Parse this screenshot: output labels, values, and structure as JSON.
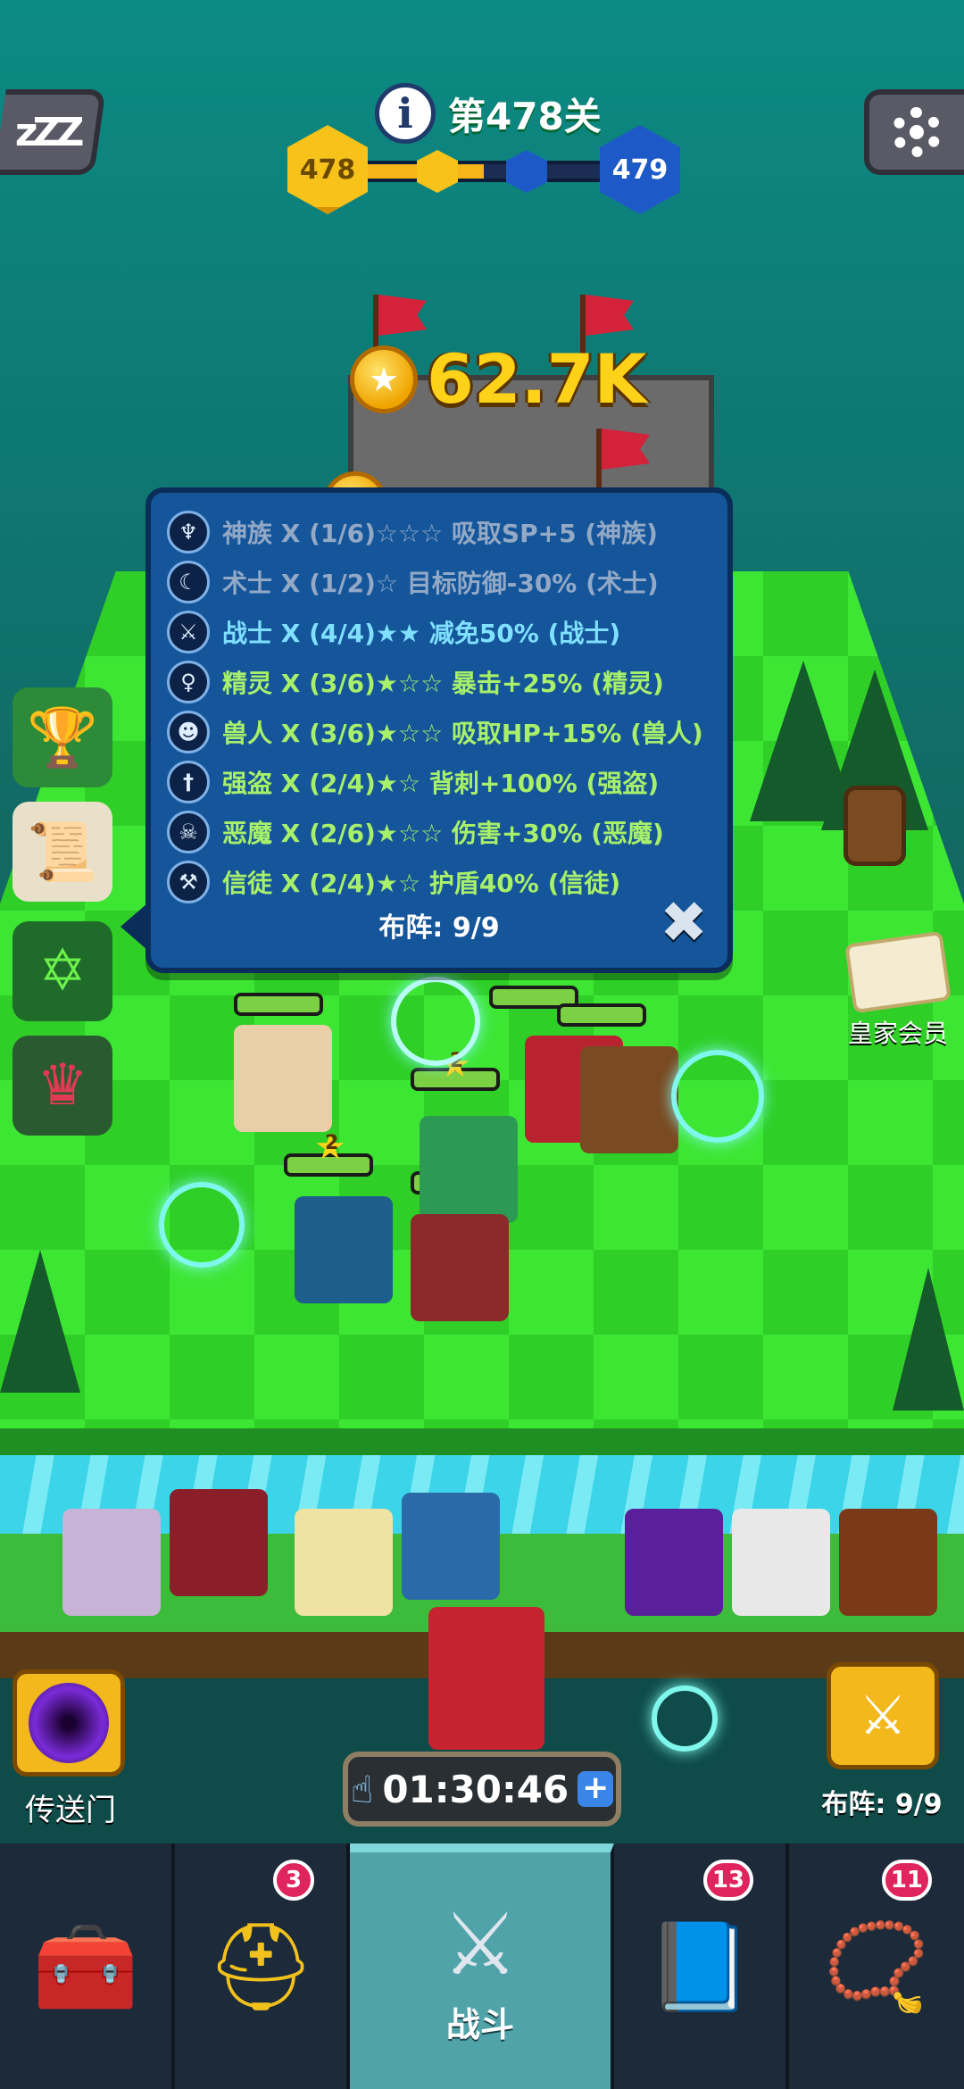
{
  "hud": {
    "level_label": "第478关",
    "current_level": "478",
    "next_level": "479",
    "progress": 0.5,
    "sleep_label": "zZZ"
  },
  "reward": {
    "amount": "62.7K"
  },
  "synergy_panel": {
    "rows": [
      {
        "icon": "wings-icon",
        "text": "神族 X (1/6)☆☆☆ 吸取SP+5 (神族)",
        "state": "dim"
      },
      {
        "icon": "warlock-icon",
        "text": "术士 X (1/2)☆ 目标防御-30% (术士)",
        "state": "dim"
      },
      {
        "icon": "sword-icon",
        "text": "战士 X (4/4)★★ 减免50% (战士)",
        "state": "full"
      },
      {
        "icon": "elf-icon",
        "text": "精灵 X (3/6)★☆☆ 暴击+25% (精灵)",
        "state": "active"
      },
      {
        "icon": "orc-icon",
        "text": "兽人 X (3/6)★☆☆ 吸取HP+15% (兽人)",
        "state": "active"
      },
      {
        "icon": "dagger-icon",
        "text": "强盗 X (2/4)★☆ 背刺+100% (强盗)",
        "state": "active"
      },
      {
        "icon": "demon-icon",
        "text": "恶魔 X (2/6)★☆☆ 伤害+30% (恶魔)",
        "state": "active"
      },
      {
        "icon": "hammer-icon",
        "text": "信徒 X (2/4)★☆ 护盾40% (信徒)",
        "state": "active"
      }
    ],
    "formation": "布阵: 9/9"
  },
  "royal_member": {
    "label": "皇家会员"
  },
  "portal": {
    "label": "传送门"
  },
  "formation_button": {
    "label": "布阵: 9/9"
  },
  "timer": {
    "value": "01:30:46"
  },
  "unit_badges": {
    "star_a": "2",
    "star_b": "2"
  },
  "tabs": [
    {
      "name": "tab-treasure",
      "icon": "treasure-chest-icon",
      "label": "",
      "badge": ""
    },
    {
      "name": "tab-heroes",
      "icon": "viking-helmet-icon",
      "label": "",
      "badge": "3"
    },
    {
      "name": "tab-battle",
      "icon": "crossed-swords-icon",
      "label": "战斗",
      "badge": ""
    },
    {
      "name": "tab-spellbook",
      "icon": "spellbook-icon",
      "label": "",
      "badge": "13"
    },
    {
      "name": "tab-amulet",
      "icon": "amulet-icon",
      "label": "",
      "badge": "11"
    }
  ],
  "colors": {
    "accent_gold": "#f7c21a",
    "panel_blue": "#15569b",
    "active_text": "#a8f06a",
    "badge_red": "#e0245e"
  }
}
